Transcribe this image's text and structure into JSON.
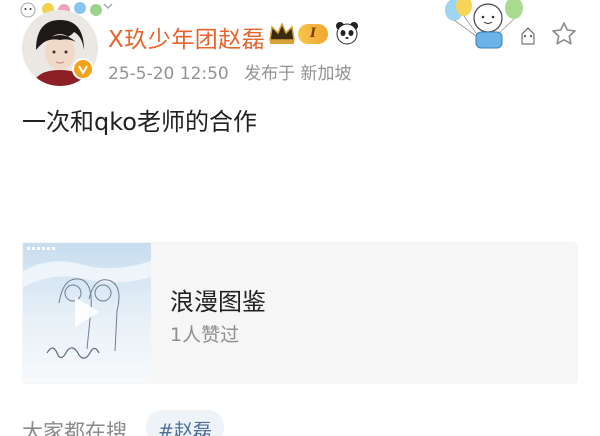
{
  "author": {
    "name": "X玖少年团赵磊",
    "level_badge": "I",
    "verified_icon": "verified-v-icon",
    "badge_icons": [
      "crown-badge-icon",
      "panda-badge-icon"
    ]
  },
  "post": {
    "date": "25-5-20 12:50",
    "location": "发布于 新加坡",
    "text": "一次和qko老师的合作"
  },
  "music_card": {
    "title": "浪漫图鉴",
    "likes": "1人赞过",
    "cover_icon": "play-icon"
  },
  "search": {
    "label": "大家都在搜",
    "tag": "#赵磊"
  },
  "colors": {
    "username": "#e8642d",
    "meta": "#939393",
    "card_bg": "#f6f6f6",
    "tag_text": "#4d6f9a",
    "tag_bg": "#eef3f8"
  }
}
